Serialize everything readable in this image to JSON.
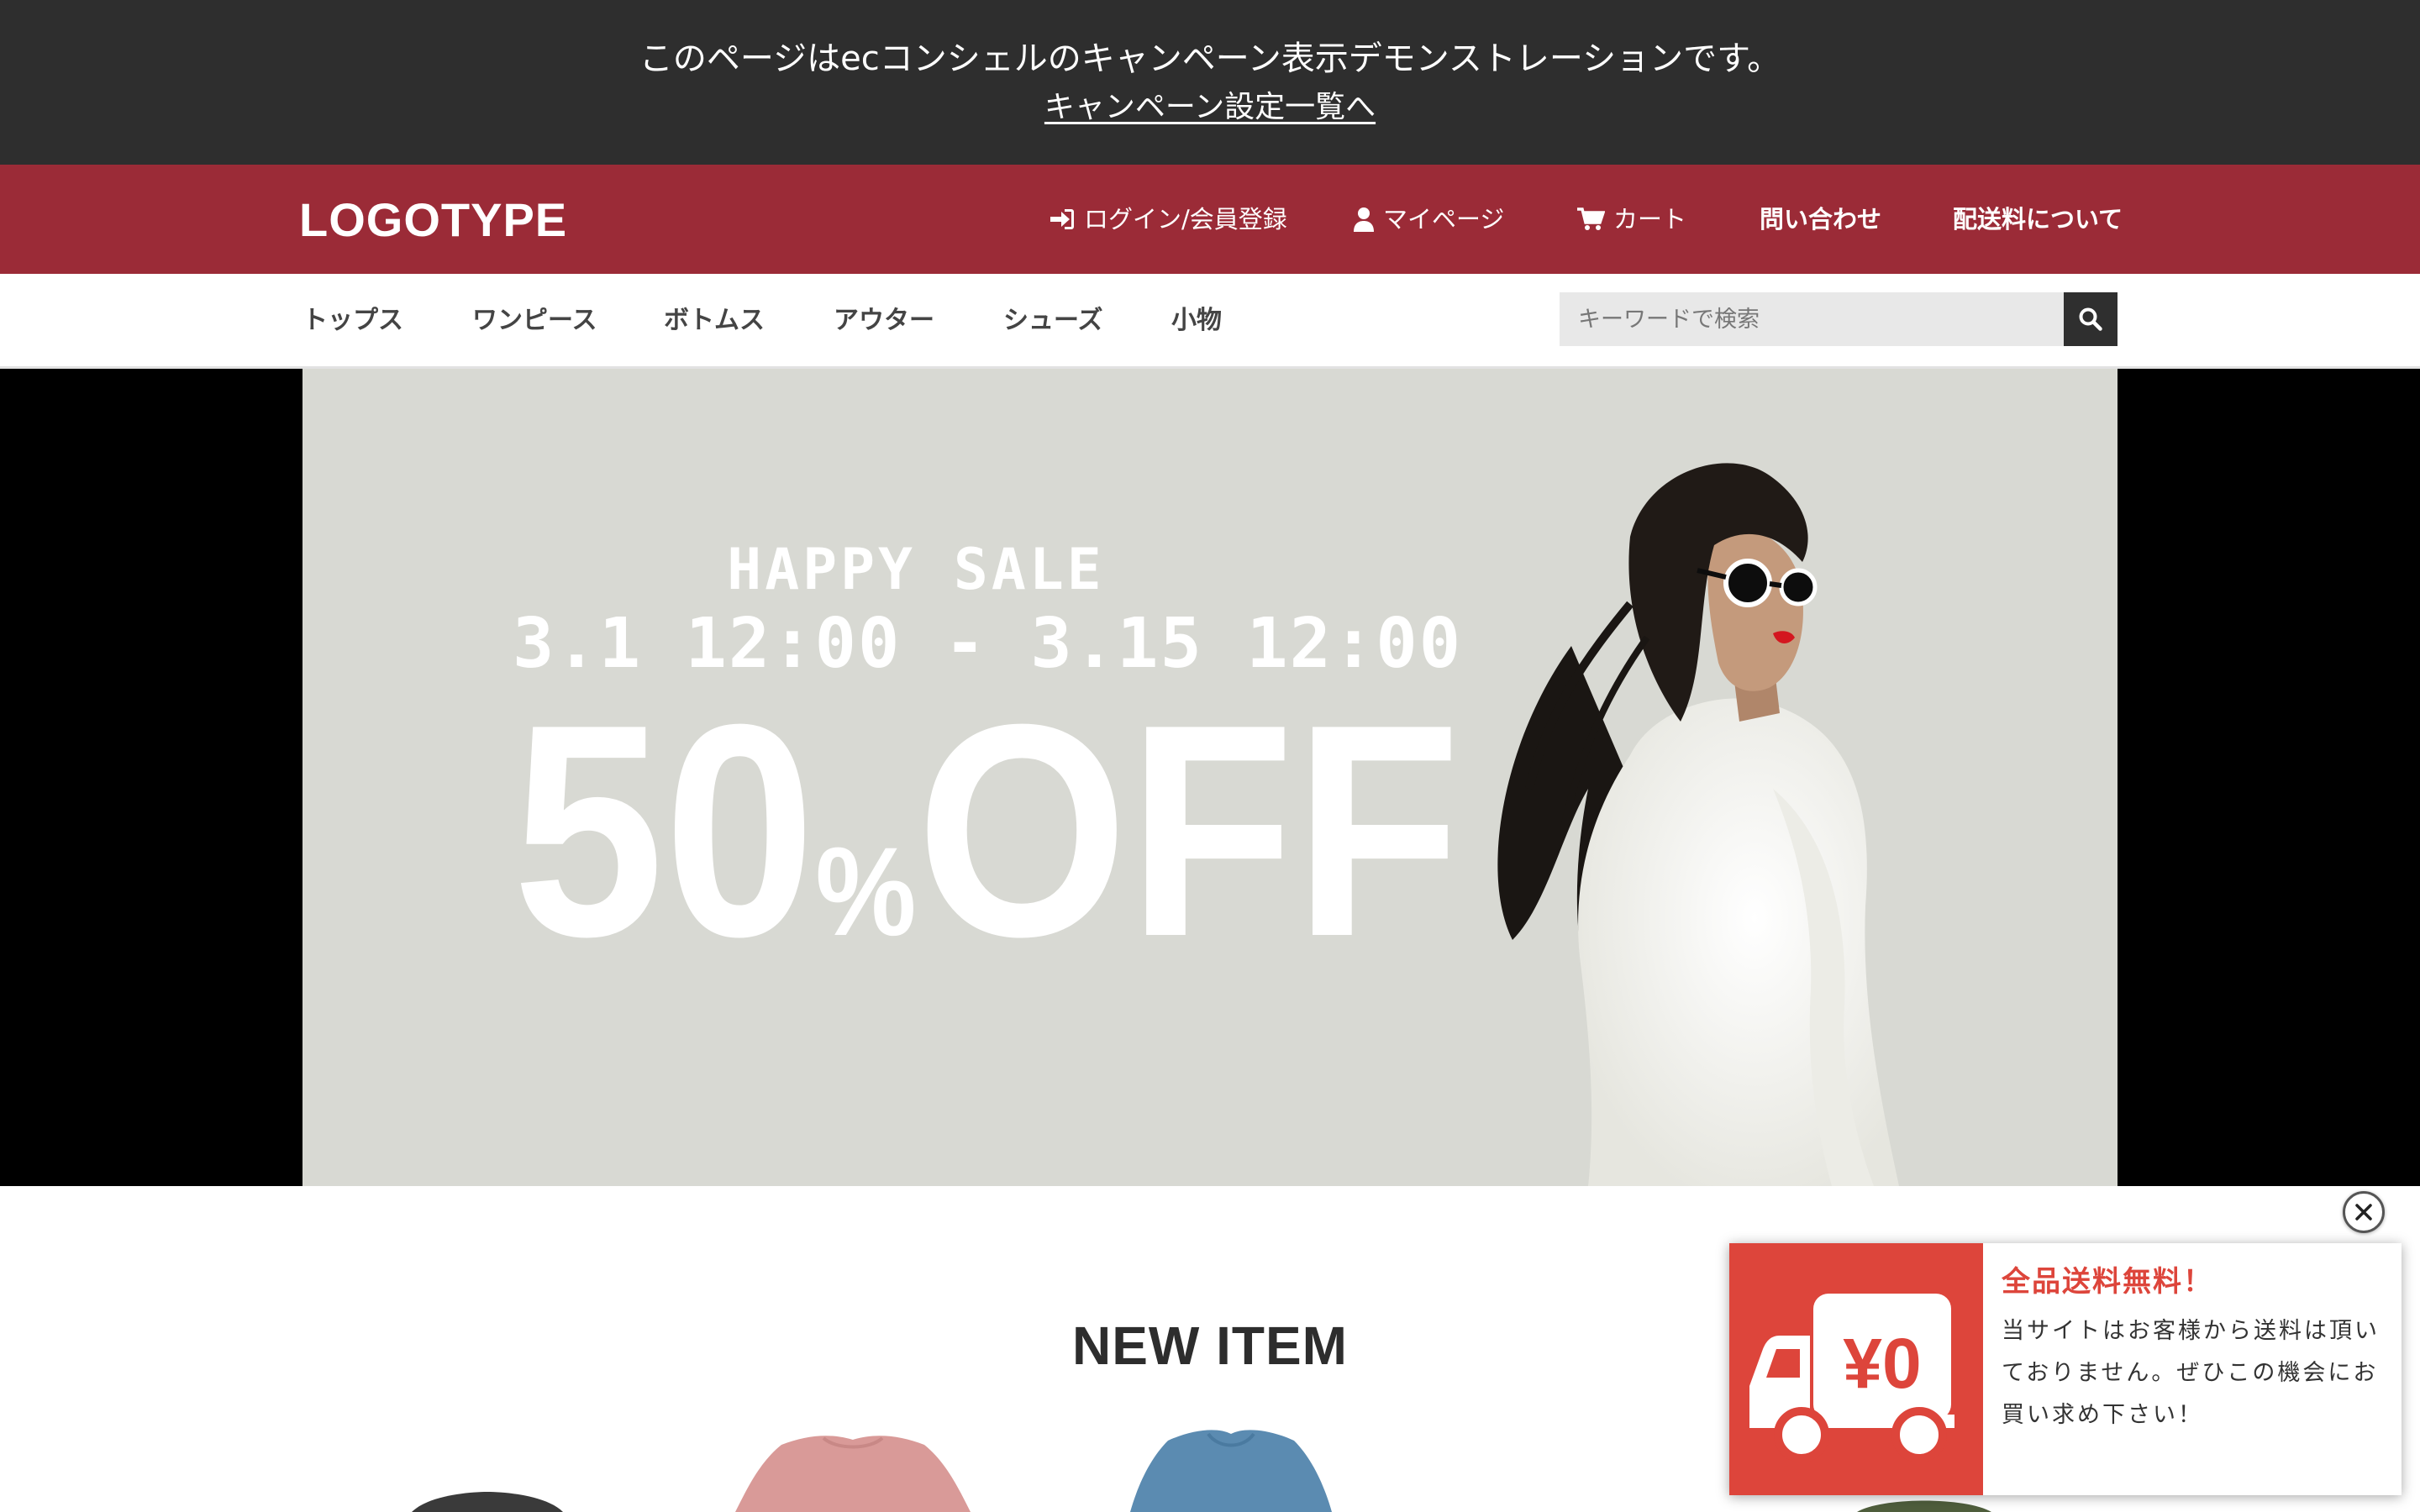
{
  "notice": {
    "message": "このページはecコンシェルのキャンペーン表示デモンストレーションです。",
    "link": "キャンペーン設定一覧へ"
  },
  "header": {
    "logo": "LOGOTYPE",
    "nav": {
      "login": "ログイン/会員登録",
      "mypage": "マイページ",
      "cart": "カート",
      "contact": "問い合わせ",
      "shipping": "配送料について"
    }
  },
  "categories": [
    "トップス",
    "ワンピース",
    "ボトムス",
    "アウター",
    "シューズ",
    "小物"
  ],
  "search": {
    "placeholder": "キーワードで検索"
  },
  "hero": {
    "title": "HAPPY SALE",
    "dates": "3.1 12:00 - 3.15 12:00",
    "discount_num": "50",
    "discount_pct": "%",
    "discount_off": "OFF"
  },
  "section": {
    "title": "NEW ITEM"
  },
  "popup": {
    "image_text": "¥0",
    "title": "全品送料無料！",
    "body": "当サイトはお客様から送料は頂いておりません。ぜひこの機会にお買い求め下さい！"
  },
  "colors": {
    "notice_bg": "#2e2e2e",
    "header_bg": "#9b2b37",
    "popup_accent": "#dd453b",
    "hero_bg": "#d8d9d3"
  }
}
